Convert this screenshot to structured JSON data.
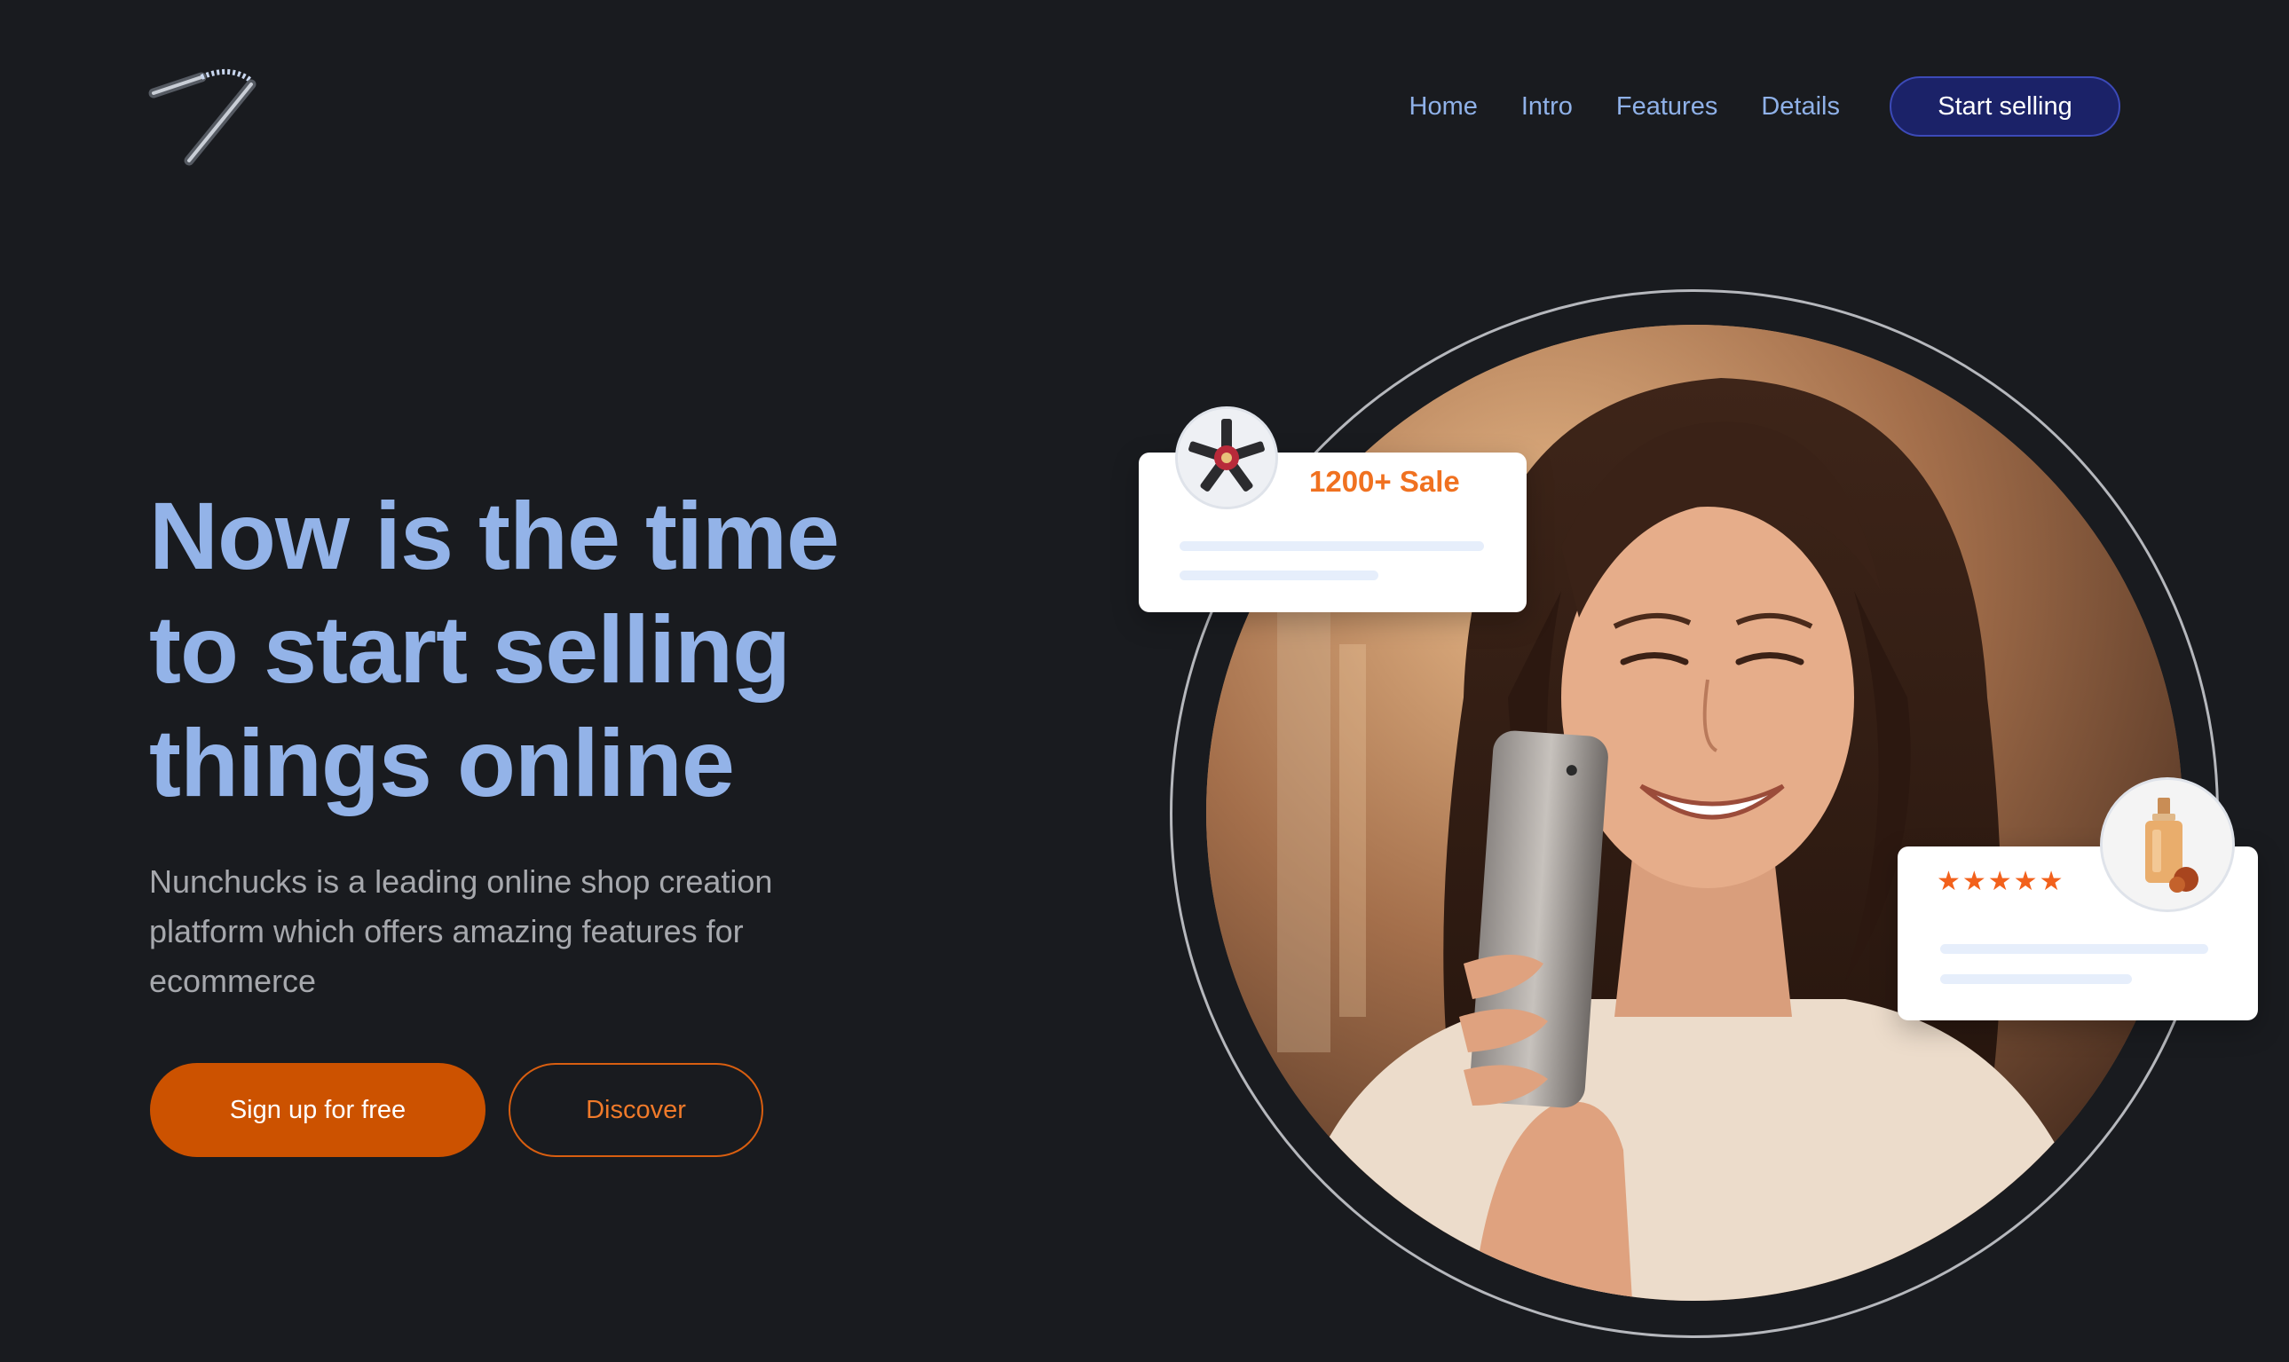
{
  "header": {
    "logo": "nunchucks-logo",
    "nav": {
      "home": "Home",
      "intro": "Intro",
      "features": "Features",
      "details": "Details",
      "cta": "Start selling"
    }
  },
  "hero": {
    "title": "Now is the time to start selling things online",
    "subtitle": "Nunchucks is a leading online shop creation platform which offers amazing features for ecommerce",
    "primary_button": "Sign up for free",
    "secondary_button": "Discover"
  },
  "visual": {
    "sale_card": {
      "text": "1200+ Sale",
      "thumbnail": "lipstick-product"
    },
    "rating_card": {
      "stars": "★★★★★",
      "rating": 5,
      "thumbnail": "perfume-product"
    },
    "photo": "woman-smiling-at-phone"
  },
  "colors": {
    "background": "#191b1f",
    "title": "#93b3e8",
    "nav_link": "#8fb1e8",
    "cta_bg": "#1b2268",
    "primary": "#cc5200",
    "accent_orange": "#f07120"
  }
}
